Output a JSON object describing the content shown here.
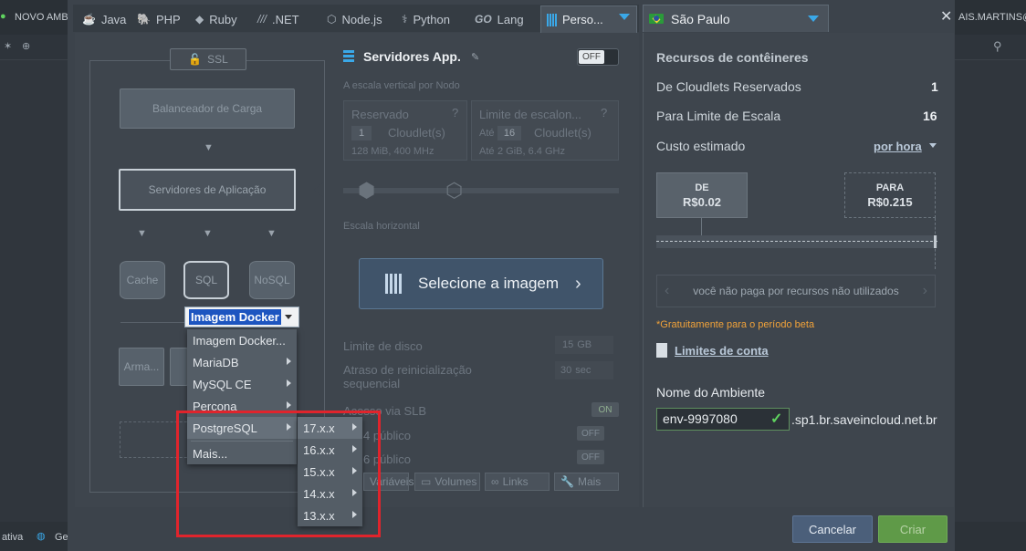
{
  "background": {
    "new_env_label": "NOVO AMBI",
    "user_label": "AIS.MARTINS@",
    "bottom_left_label": "ativa",
    "bottom_left_label2": "Ge"
  },
  "tabs": [
    {
      "label": "Java",
      "icon": "java-icon"
    },
    {
      "label": "PHP",
      "icon": "php-icon"
    },
    {
      "label": "Ruby",
      "icon": "ruby-icon"
    },
    {
      "label": ".NET",
      "icon": "dotnet-icon"
    },
    {
      "label": "Node.js",
      "icon": "nodejs-icon"
    },
    {
      "label": "Python",
      "icon": "python-icon"
    },
    {
      "label": "Lang",
      "icon": "go-icon",
      "prefix": "GO"
    },
    {
      "label": "Perso...",
      "icon": "custom-docker-icon",
      "active": true
    }
  ],
  "region": {
    "label": "São Paulo"
  },
  "topology": {
    "ssl": "SSL",
    "load_balancer": "Balanceador de Carga",
    "app_servers": "Servidores de Aplicação",
    "cache": "Cache",
    "sql": "SQL",
    "nosql": "NoSQL",
    "storage": "Arma..."
  },
  "docker_select": {
    "value": "Imagem Docker"
  },
  "menu": {
    "items": [
      {
        "label": "Imagem Docker...",
        "submenu": false
      },
      {
        "label": "MariaDB",
        "submenu": true
      },
      {
        "label": "MySQL CE",
        "submenu": true
      },
      {
        "label": "Percona",
        "submenu": true
      },
      {
        "label": "PostgreSQL",
        "submenu": true,
        "selected": true
      },
      {
        "label": "Mais...",
        "submenu": false
      }
    ],
    "postgres_versions": [
      {
        "label": "17.x.x",
        "selected": true
      },
      {
        "label": "16.x.x"
      },
      {
        "label": "15.x.x"
      },
      {
        "label": "14.x.x"
      },
      {
        "label": "13.x.x"
      }
    ]
  },
  "app_config": {
    "title": "Servidores App.",
    "toggle": "OFF",
    "vertical_scaling": "A escala vertical por Nodo",
    "reserved_label": "Reservado",
    "reserved_value": "1",
    "reserved_unit": "Cloudlet(s)",
    "reserved_info": "128 MiB, 400 MHz",
    "limit_label": "Limite de escalon...",
    "limit_prefix": "Até",
    "limit_value": "16",
    "limit_unit": "Cloudlet(s)",
    "limit_info_prefix": "Até",
    "limit_info": "2 GiB, 6.4 GHz",
    "horizontal_scaling": "Escala horizontal",
    "select_image": "Selecione a imagem",
    "disk_limit_label": "Limite de disco",
    "disk_limit_value": "15",
    "disk_limit_unit": "GB",
    "restart_delay_label": "Atraso de reinicialização sequencial",
    "restart_delay_value": "30",
    "restart_delay_unit": "sec",
    "slb_label": "Acesso via SLB",
    "slb_toggle": "ON",
    "ipv4_label": "4 público",
    "ipv4_toggle": "OFF",
    "ipv6_label": "6 público",
    "ipv6_toggle": "OFF",
    "tab_vars": "Variáveis",
    "tab_volumes": "Volumes",
    "tab_links": "Links",
    "tab_more": "Mais"
  },
  "resources": {
    "title": "Recursos de contêineres",
    "reserved_label": "De Cloudlets Reservados",
    "reserved_value": "1",
    "limit_label": "Para Limite de Escala",
    "limit_value": "16",
    "cost_label": "Custo estimado",
    "cost_period": "por hora",
    "from_label": "DE",
    "from_price": "R$0.02",
    "to_label": "PARA",
    "to_price": "R$0.215",
    "no_charge": "você não paga por recursos não utilizados",
    "beta_note": "*Gratuitamente para o período beta",
    "account_limits": "Limites de conta"
  },
  "environment": {
    "label": "Nome do Ambiente",
    "name": "env-9997080",
    "domain": ".sp1.br.saveincloud.net.br"
  },
  "footer": {
    "cancel": "Cancelar",
    "create": "Criar"
  },
  "colors": {
    "accent": "#3aa8e8",
    "create": "#5f9a48",
    "cancel": "#4b5f7a",
    "highlight": "#e0242c"
  }
}
